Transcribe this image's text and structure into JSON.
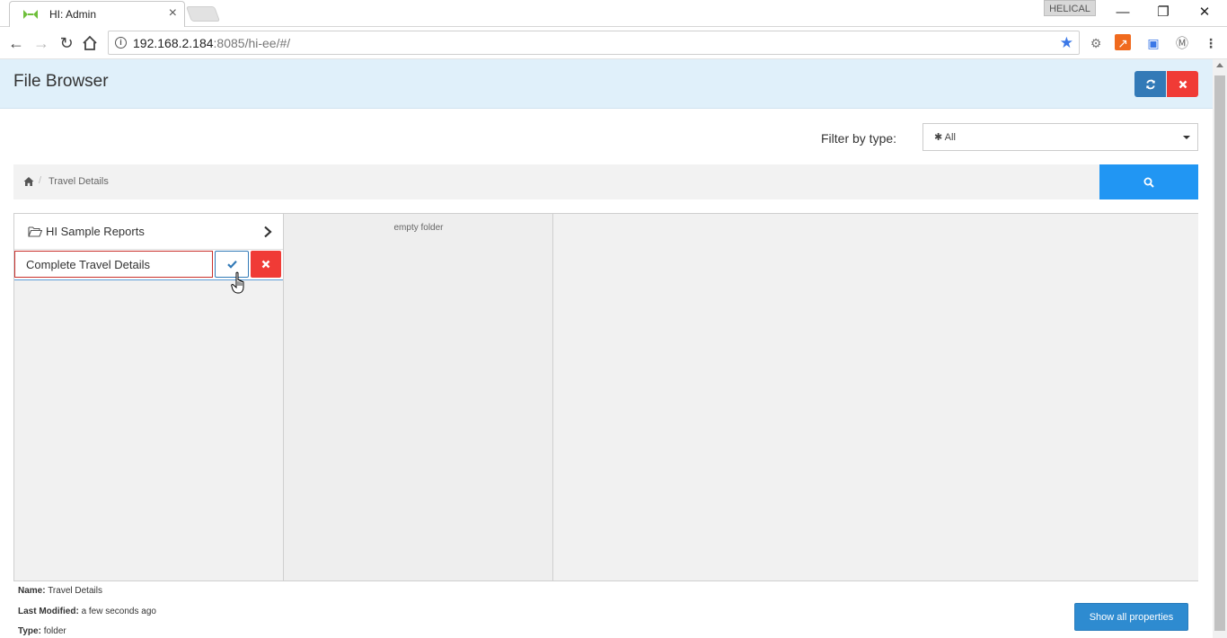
{
  "browser": {
    "tab_title": "HI: Admin",
    "profile_name": "HELICAL",
    "url_host": "192.168.2.184",
    "url_rest": ":8085/hi-ee/#/"
  },
  "app": {
    "title": "File Browser",
    "filter": {
      "label": "Filter by type:",
      "value": "✱ All"
    },
    "breadcrumb": {
      "current": "Travel Details"
    },
    "folder_item": {
      "label": "HI Sample Reports"
    },
    "rename": {
      "value": "Complete Travel Details"
    },
    "middle_pane": {
      "empty_text": "empty folder"
    },
    "properties": {
      "name_label": "Name:",
      "name_value": "Travel Details",
      "modified_label": "Last Modified:",
      "modified_value": "a few seconds ago",
      "type_label": "Type:",
      "type_value": "folder"
    },
    "show_props_label": "Show all properties"
  },
  "colors": {
    "accent": "#2196f3",
    "danger": "#f03b36",
    "primary": "#337ab7",
    "header_bg": "#e0f0fa"
  }
}
